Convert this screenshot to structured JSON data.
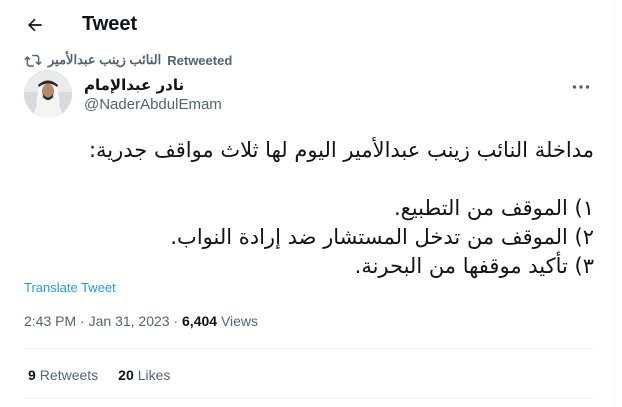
{
  "header": {
    "title": "Tweet",
    "back_icon": "arrow-left-icon"
  },
  "retweet": {
    "icon": "retweet-icon",
    "by_name": "النائب زينب عبدالأمير",
    "label": "Retweeted"
  },
  "author": {
    "name": "نادر عبدالإمام",
    "handle": "@NaderAbdulEmam",
    "more_icon": "more-icon"
  },
  "tweet": {
    "lines": [
      "مداخلة النائب زينب عبدالأمير اليوم لها ثلاث مواقف جدرية:",
      "",
      "١) الموقف من التطبيع.",
      "٢) الموقف من تدخل المستشار ضد إرادة النواب.",
      "٣) تأكيد موقفها من البحرنة."
    ]
  },
  "translate_label": "Translate Tweet",
  "meta": {
    "time": "2:43 PM",
    "sep1": " · ",
    "date": "Jan 31, 2023",
    "sep2": " · ",
    "views_count": "6,404",
    "views_label": " Views"
  },
  "stats": {
    "retweets_count": "9",
    "retweets_label": "Retweets",
    "likes_count": "20",
    "likes_label": "Likes"
  },
  "colors": {
    "accent": "#1d9bf0",
    "secondary_text": "#536471",
    "primary_text": "#0f1419",
    "divider": "#eff3f4"
  }
}
